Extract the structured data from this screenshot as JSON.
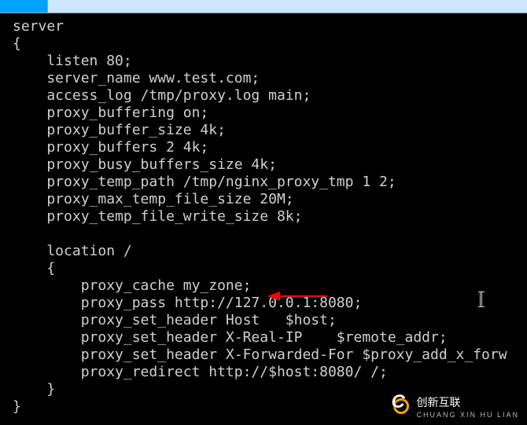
{
  "code_lines": [
    "server",
    "{",
    "    listen 80;",
    "    server_name www.test.com;",
    "    access_log /tmp/proxy.log main;",
    "    proxy_buffering on;",
    "    proxy_buffer_size 4k;",
    "    proxy_buffers 2 4k;",
    "    proxy_busy_buffers_size 4k;",
    "    proxy_temp_path /tmp/nginx_proxy_tmp 1 2;",
    "    proxy_max_temp_file_size 20M;",
    "    proxy_temp_file_write_size 8k;",
    "",
    "    location /",
    "    {",
    "        proxy_cache my_zone;",
    "        proxy_pass http://127.0.0.1:8080;",
    "        proxy_set_header Host   $host;",
    "        proxy_set_header X-Real-IP    $remote_addr;",
    "        proxy_set_header X-Forwarded-For $proxy_add_x_forw",
    "        proxy_redirect http://$host:8080/ /;",
    "    }",
    "}"
  ],
  "watermark": {
    "brand": "创新互联",
    "sub": "CHUANG XIN HU LIAN"
  },
  "annotation": {
    "arrow_target_line": 15
  }
}
